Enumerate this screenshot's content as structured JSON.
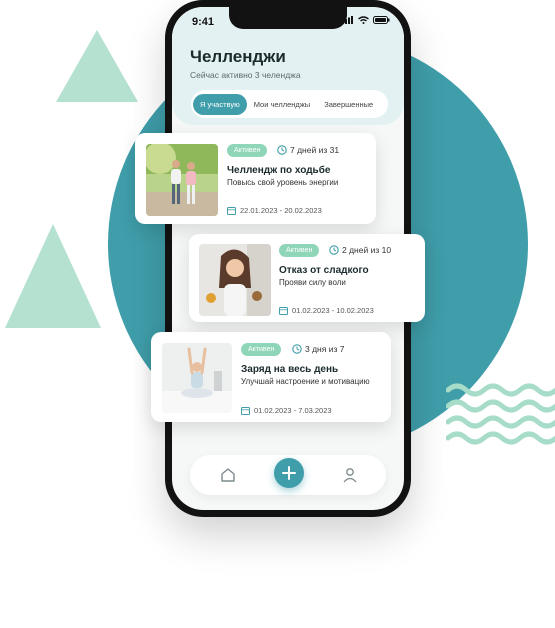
{
  "status_bar": {
    "time": "9:41"
  },
  "header": {
    "title": "Челленджи",
    "subtitle": "Сейчас активно 3 челенджа"
  },
  "tabs": [
    {
      "label": "Я участвую",
      "active": true
    },
    {
      "label": "Мои челленджы",
      "active": false
    },
    {
      "label": "Завершенные",
      "active": false
    }
  ],
  "challenges": [
    {
      "status": "Активен",
      "progress": "7 дней из 31",
      "title": "Челлендж по ходьбе",
      "subtitle": "Повысь свой уровень энергии",
      "dates": "22.01.2023 - 20.02.2023"
    },
    {
      "status": "Активен",
      "progress": "2 дней из 10",
      "title": "Отказ от сладкого",
      "subtitle": "Прояви силу воли",
      "dates": "01.02.2023 - 10.02.2023"
    },
    {
      "status": "Активен",
      "progress": "3 дня из 7",
      "title": "Заряд на весь день",
      "subtitle": "Улучшай настроение и мотивацию",
      "dates": "01.02.2023 - 7.03.2023"
    }
  ],
  "colors": {
    "accent": "#3f9eaa",
    "badge": "#8fd6b8",
    "decor_green": "#a7dcc8"
  },
  "icons": {
    "home": "home-icon",
    "add": "plus-icon",
    "profile": "user-icon",
    "clock": "clock-icon",
    "calendar": "calendar-icon"
  }
}
